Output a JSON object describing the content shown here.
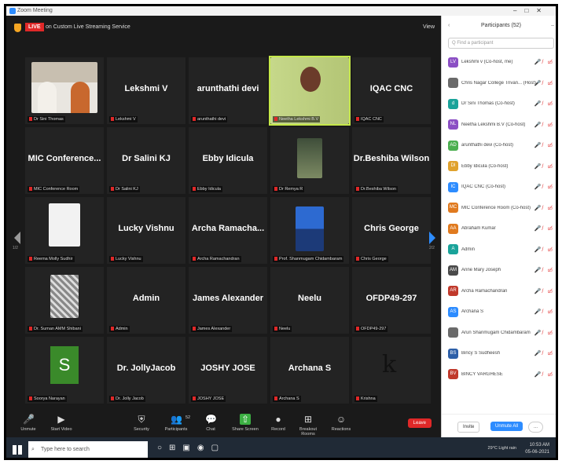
{
  "titlebar": {
    "title": "Zoom Meeting"
  },
  "topbar": {
    "live_badge": "LIVE",
    "stream_label": "on Custom Live Streaming Service",
    "view_label": "View"
  },
  "tiles": [
    {
      "name": "",
      "label": "Dr Sini Thomas",
      "photo": "room"
    },
    {
      "name": "Lekshmi V",
      "label": "Lekshmi V"
    },
    {
      "name": "arunthathi devi",
      "label": "arunthathi devi"
    },
    {
      "name": "",
      "label": "Neetha Lekshmi B.V",
      "photo": "woman"
    },
    {
      "name": "IQAC CNC",
      "label": "IQAC CNC"
    },
    {
      "name": "MIC Conference...",
      "label": "MIC Conference Room"
    },
    {
      "name": "Dr Salini KJ",
      "label": "Dr Salini KJ"
    },
    {
      "name": "Ebby Idicula",
      "label": "Ebby Idicula"
    },
    {
      "name": "",
      "label": "Dr Remya R",
      "photo": "man"
    },
    {
      "name": "Dr.Beshiba Wilson",
      "label": "Dr.Beshiba Wilson"
    },
    {
      "name": "",
      "label": "Reema Molly Sudhir",
      "photo": "doc"
    },
    {
      "name": "Lucky Vishnu",
      "label": "Lucky Vishnu"
    },
    {
      "name": "Archa Ramacha...",
      "label": "Archa Ramachandran"
    },
    {
      "name": "",
      "label": "Prof. Shanmugam Chidambaram",
      "photo": "suit"
    },
    {
      "name": "Chris George",
      "label": "Chris George"
    },
    {
      "name": "",
      "label": "Dr. Suman AMM Shibani",
      "photo": "pat"
    },
    {
      "name": "Admin",
      "label": "Admin"
    },
    {
      "name": "James Alexander",
      "label": "James Alexander"
    },
    {
      "name": "Neelu",
      "label": "Neelu"
    },
    {
      "name": "OFDP49-297",
      "label": "OFDP49-297"
    },
    {
      "name": "",
      "label": "Soorya Narayan",
      "photo": "s",
      "letter": "S"
    },
    {
      "name": "Dr. JollyJacob",
      "label": "Dr. Jolly Jacob"
    },
    {
      "name": "JOSHY JOSE",
      "label": "JOSHY JOSE"
    },
    {
      "name": "Archana S",
      "label": "Archana S"
    },
    {
      "name": "",
      "label": "Krishna",
      "photo": "k",
      "letter": "k"
    }
  ],
  "page": {
    "left": "1/2",
    "right": "2/2"
  },
  "panel": {
    "title": "Participants (52)",
    "search_placeholder": "Q Find a participant",
    "participants": [
      {
        "initials": "LV",
        "name": "Lekshmi v (Co-host, me)",
        "color": "#8b4fc4"
      },
      {
        "initials": "",
        "name": "Chris Nagar College Trivan... (Host)",
        "color": "#6a6a6a"
      },
      {
        "initials": "d",
        "name": "Dr Sini Thomas (Co-host)",
        "color": "#1aa39a"
      },
      {
        "initials": "NL",
        "name": "Neetha Lekshmi B.V (Co-host)",
        "color": "#8b4fc4"
      },
      {
        "initials": "AD",
        "name": "arunthathi devi (Co-host)",
        "color": "#4caf50"
      },
      {
        "initials": "DI",
        "name": "Ebby Idicula (Co-host)",
        "color": "#e0a22d"
      },
      {
        "initials": "IC",
        "name": "IQAC CNC (Co-host)",
        "color": "#2d8cff"
      },
      {
        "initials": "MC",
        "name": "MIC Conference Room (Co-host)",
        "color": "#e07a1f"
      },
      {
        "initials": "AA",
        "name": "Abraham Kumar",
        "color": "#e07a1f"
      },
      {
        "initials": "A",
        "name": "Admin",
        "color": "#1aa39a"
      },
      {
        "initials": "AM",
        "name": "Anne Mary Joseph",
        "color": "#4a4a4a"
      },
      {
        "initials": "AR",
        "name": "Archa Ramachandran",
        "color": "#c0392b"
      },
      {
        "initials": "AS",
        "name": "Archana S",
        "color": "#2d8cff"
      },
      {
        "initials": "",
        "name": "Arun Shanmugam Chidambaram",
        "color": "#6a6a6a"
      },
      {
        "initials": "BS",
        "name": "Bincy S Sudheesh",
        "color": "#2d5fa8"
      },
      {
        "initials": "BV",
        "name": "BINCY VARGHESE",
        "color": "#c0392b"
      }
    ],
    "invite": "Invite",
    "unmute_all": "Unmute All",
    "more": "..."
  },
  "toolbar": {
    "items": [
      "Unmute",
      "Start Video",
      "Security",
      "Participants",
      "Chat",
      "Share Screen",
      "Record",
      "Breakout Rooms",
      "Reactions"
    ],
    "participants_count": "52",
    "end": "Leave"
  },
  "taskbar": {
    "search": "Type here to search",
    "tray": "29°C Light rain",
    "time": "10:53 AM",
    "date": "05-06-2021"
  }
}
